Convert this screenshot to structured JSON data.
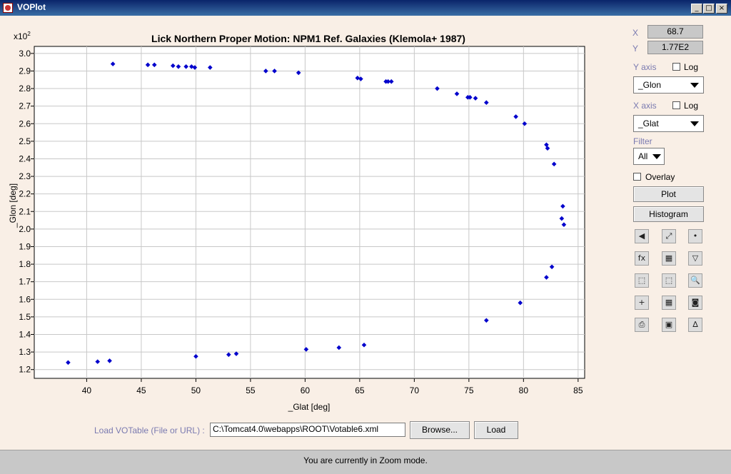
{
  "window": {
    "title": "VOPlot",
    "minimize": "_",
    "maximize": "□",
    "close": "×"
  },
  "chart_data": {
    "type": "scatter",
    "title": "Lick Northern Proper Motion: NPM1 Ref. Galaxies (Klemola+ 1987)",
    "xlabel": "_Glat [deg]",
    "ylabel": "_Glon [deg]",
    "y_multiplier_label": "x10",
    "y_multiplier_exp": "2",
    "xlim": [
      35.2,
      85.6
    ],
    "ylim": [
      1.15,
      3.04
    ],
    "xticks": [
      40,
      45,
      50,
      55,
      60,
      65,
      70,
      75,
      80,
      85
    ],
    "yticks": [
      1.2,
      1.3,
      1.4,
      1.5,
      1.6,
      1.7,
      1.8,
      1.9,
      2.0,
      2.1,
      2.2,
      2.3,
      2.4,
      2.5,
      2.6,
      2.7,
      2.8,
      2.9,
      3.0
    ],
    "grid": true,
    "marker_color": "#0000cc",
    "series": [
      {
        "x": [
          42.4,
          45.6,
          46.2,
          47.9,
          48.4,
          49.1,
          49.6,
          49.9,
          51.3,
          56.4,
          57.2,
          59.4,
          64.8,
          65.1,
          67.4,
          67.6,
          67.9,
          72.1,
          73.9,
          74.9,
          75.1,
          75.6,
          76.6,
          79.3,
          80.1,
          82.1,
          82.2,
          82.8,
          83.6,
          83.7,
          83.5,
          82.6,
          82.1,
          79.7,
          76.6,
          65.4,
          63.1,
          60.1,
          53.7,
          53.0,
          50.0,
          42.1,
          41.0,
          38.3
        ],
        "y": [
          2.94,
          2.935,
          2.935,
          2.93,
          2.925,
          2.925,
          2.925,
          2.92,
          2.92,
          2.9,
          2.9,
          2.89,
          2.86,
          2.855,
          2.84,
          2.84,
          2.84,
          2.8,
          2.77,
          2.75,
          2.75,
          2.745,
          2.72,
          2.64,
          2.6,
          2.48,
          2.46,
          2.37,
          2.13,
          2.025,
          2.06,
          1.785,
          1.725,
          1.58,
          1.48,
          1.34,
          1.325,
          1.315,
          1.29,
          1.285,
          1.275,
          1.25,
          1.245,
          1.24
        ]
      }
    ]
  },
  "sidebar": {
    "x_label": "X",
    "x_value": "68.7",
    "y_label": "Y",
    "y_value": "1.77E2",
    "yaxis_label": "Y axis",
    "yaxis_log_label": "Log",
    "yaxis_selected": "_Glon",
    "xaxis_label": "X axis",
    "xaxis_log_label": "Log",
    "xaxis_selected": "_Glat",
    "filter_label": "Filter",
    "filter_selected": "All",
    "overlay_label": "Overlay",
    "plot_button": "Plot",
    "histogram_button": "Histogram",
    "tools": [
      "back-icon",
      "fit-icon",
      "mark-point-icon",
      "function-icon",
      "color-icon",
      "filter-icon",
      "select-region-icon",
      "crop-icon",
      "zoom-icon",
      "add-point-icon",
      "table-icon",
      "view-icon",
      "print-icon",
      "save-icon",
      "stats-icon"
    ],
    "tool_glyphs": [
      "◀",
      "⤢",
      "•",
      "fx",
      "▦",
      "▽",
      "⬚",
      "⬚",
      "🔍",
      "+",
      "▦",
      "◙",
      "⎙",
      "▣",
      "∆"
    ]
  },
  "load": {
    "label": "Load VOTable (File or URL) :",
    "path_value": "C:\\Tomcat4.0\\webapps\\ROOT\\Votable6.xml",
    "browse_button": "Browse...",
    "load_button": "Load"
  },
  "status": {
    "text": "You are currently in Zoom mode."
  }
}
